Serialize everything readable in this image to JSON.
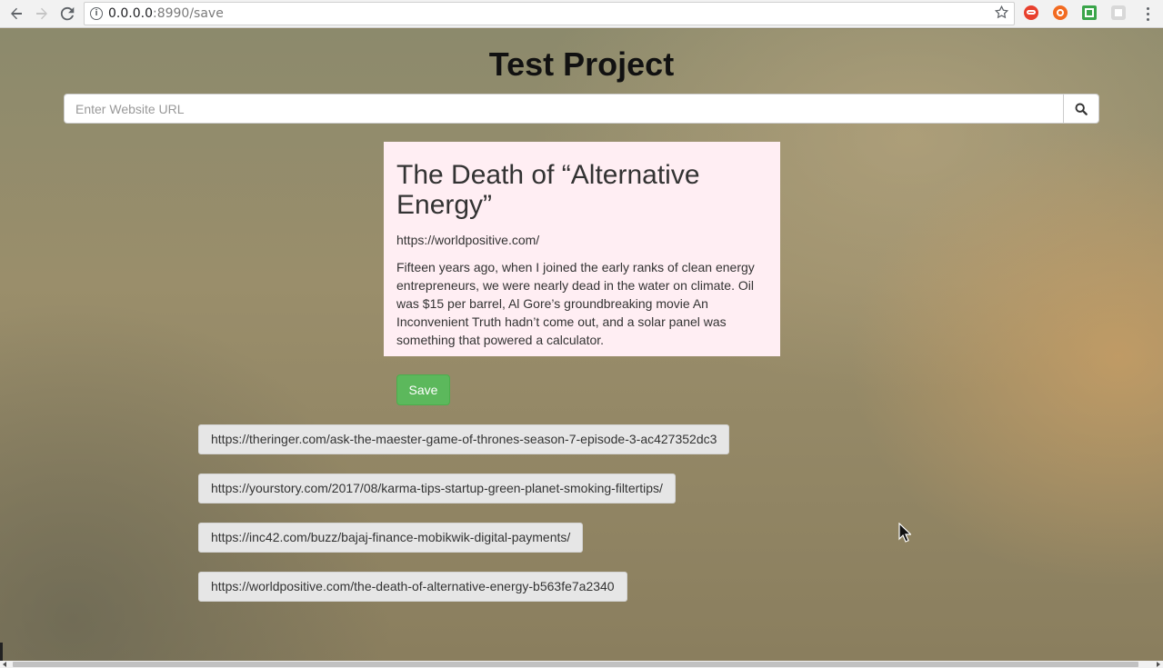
{
  "browser": {
    "url_host": "0.0.0.0",
    "url_path": ":8990/save",
    "icons": [
      "back-arrow-icon",
      "forward-arrow-icon",
      "reload-icon",
      "info-icon",
      "star-icon",
      "extension-icons",
      "menu-icon"
    ]
  },
  "page": {
    "title": "Test Project",
    "search": {
      "placeholder": "Enter Website URL",
      "value": "",
      "button_icon": "search-icon"
    },
    "article": {
      "title": "The Death of “Alternative Energy”",
      "url": "https://worldpositive.com/",
      "summary": "Fifteen years ago, when I joined the early ranks of clean energy entrepreneurs, we were nearly dead in the water on climate. Oil was $15 per barrel, Al Gore’s groundbreaking movie An Inconvenient Truth hadn’t come out, and a solar panel was something that powered a calculator."
    },
    "save_label": "Save",
    "saved_links": [
      "https://theringer.com/ask-the-maester-game-of-thrones-season-7-episode-3-ac427352dc3",
      "https://yourstory.com/2017/08/karma-tips-startup-green-planet-smoking-filtertips/",
      "https://inc42.com/buzz/bajaj-finance-mobikwik-digital-payments/",
      "https://worldpositive.com/the-death-of-alternative-energy-b563fe7a2340"
    ],
    "colors": {
      "save_button": "#5cb85c",
      "card_background": "#ffeef3",
      "link_button": "#e6e6e6"
    }
  }
}
